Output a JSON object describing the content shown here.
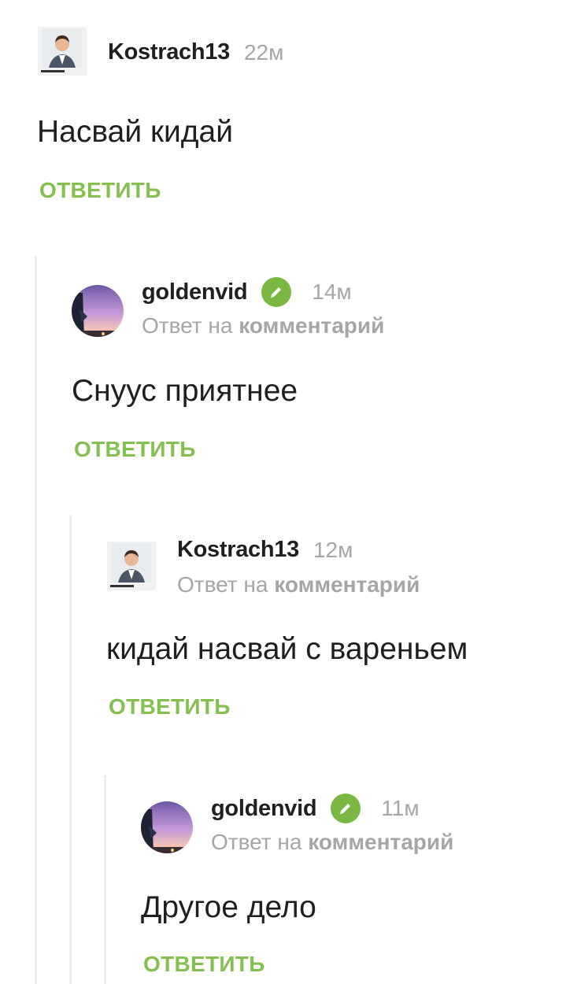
{
  "comments": [
    {
      "username": "Kostrach13",
      "timestamp": "22м",
      "verified": false,
      "reply_prefix": "",
      "reply_target": "",
      "text": "Насвай кидай",
      "reply_label": "ОТВЕТИТЬ",
      "avatar": "person-photo"
    },
    {
      "username": "goldenvid",
      "timestamp": "14м",
      "verified": true,
      "reply_prefix": "Ответ на ",
      "reply_target": "комментарий",
      "text": "Снуус приятнее",
      "reply_label": "ОТВЕТИТЬ",
      "avatar": "sunset-photo"
    },
    {
      "username": "Kostrach13",
      "timestamp": "12м",
      "verified": false,
      "reply_prefix": "Ответ на ",
      "reply_target": "комментарий",
      "text": "кидай насвай с вареньем",
      "reply_label": "ОТВЕТИТЬ",
      "avatar": "person-photo"
    },
    {
      "username": "goldenvid",
      "timestamp": "11м",
      "verified": true,
      "reply_prefix": "Ответ на ",
      "reply_target": "комментарий",
      "text": "Другое дело",
      "reply_label": "ОТВЕТИТЬ",
      "avatar": "sunset-photo"
    }
  ],
  "colors": {
    "accent_green": "#84c04f",
    "verified_badge": "#7ab843",
    "muted_text": "#a6a6a6",
    "thread_line": "#ececec"
  },
  "icons": {
    "verified": "pencil-in-green-circle"
  }
}
